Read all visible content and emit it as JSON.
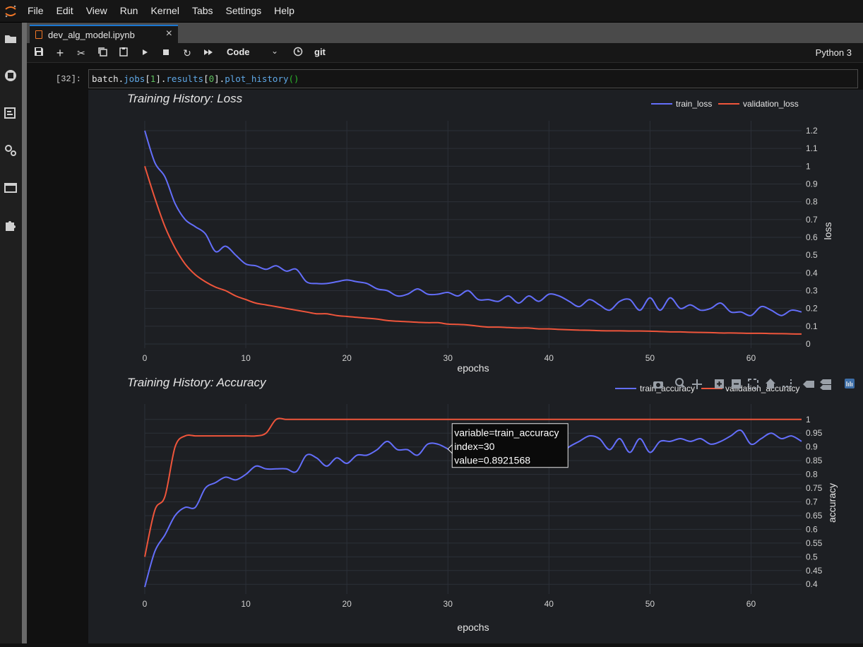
{
  "menubar": {
    "items": [
      "File",
      "Edit",
      "View",
      "Run",
      "Kernel",
      "Tabs",
      "Settings",
      "Help"
    ]
  },
  "sidebar": {
    "icons": [
      "folder-icon",
      "running-icon",
      "commands-icon",
      "property-inspector-icon",
      "tabs-icon",
      "extensions-icon"
    ]
  },
  "tab": {
    "title": "dev_alg_model.ipynb",
    "close_label": "×"
  },
  "toolbar": {
    "cell_type": "Code",
    "git_label": "git",
    "kernel_name": "Python 3",
    "icons": [
      "save-icon",
      "add-icon",
      "cut-icon",
      "copy-icon",
      "paste-icon",
      "run-icon",
      "stop-icon",
      "restart-icon",
      "fast-forward-icon",
      "clock-icon"
    ]
  },
  "cell": {
    "prompt": "[32]:",
    "code": {
      "t1": "batch.",
      "t2": "jobs",
      "t3": "[",
      "t4": "1",
      "t5": "].",
      "t6": "results",
      "t7": "[",
      "t8": "0",
      "t9": "].",
      "t10": "plot_history",
      "t11": "()"
    }
  },
  "colors": {
    "train": "#636efa",
    "validation": "#ef553b",
    "plot_bg": "#1d1f23",
    "grid": "#2c3038"
  },
  "modebar": {
    "icons": [
      "camera-icon",
      "zoom-icon",
      "pan-icon",
      "zoom-in-icon",
      "zoom-out-icon",
      "autoscale-icon",
      "home-icon",
      "spike-lines-icon",
      "hover-closest-icon",
      "hover-compare-icon",
      "plotly-logo-icon"
    ]
  },
  "chart_data": [
    {
      "type": "line",
      "title": "Training History: Loss",
      "xlabel": "epochs",
      "ylabel": "loss",
      "xlim": [
        0,
        65
      ],
      "ylim": [
        0,
        1.2
      ],
      "x_ticks": [
        0,
        10,
        20,
        30,
        40,
        50,
        60
      ],
      "y_ticks": [
        0,
        0.1,
        0.2,
        0.3,
        0.4,
        0.5,
        0.6,
        0.7,
        0.8,
        0.9,
        1,
        1.1,
        1.2
      ],
      "y_tick_labels": [
        "0",
        "0.1",
        "0.2",
        "0.3",
        "0.4",
        "0.5",
        "0.6",
        "0.7",
        "0.8",
        "0.9",
        "1",
        "1.1",
        "1.2"
      ],
      "grid": true,
      "legend_position": "top-right",
      "series": [
        {
          "name": "train_loss",
          "x": [
            0,
            1,
            2,
            3,
            4,
            5,
            6,
            7,
            8,
            9,
            10,
            11,
            12,
            13,
            14,
            15,
            16,
            17,
            18,
            19,
            20,
            21,
            22,
            23,
            24,
            25,
            26,
            27,
            28,
            29,
            30,
            31,
            32,
            33,
            34,
            35,
            36,
            37,
            38,
            39,
            40,
            41,
            42,
            43,
            44,
            45,
            46,
            47,
            48,
            49,
            50,
            51,
            52,
            53,
            54,
            55,
            56,
            57,
            58,
            59,
            60,
            61,
            62,
            63,
            64,
            65
          ],
          "values": [
            1.2,
            1.02,
            0.94,
            0.79,
            0.7,
            0.66,
            0.62,
            0.52,
            0.55,
            0.5,
            0.45,
            0.44,
            0.42,
            0.44,
            0.41,
            0.42,
            0.35,
            0.34,
            0.34,
            0.35,
            0.36,
            0.35,
            0.34,
            0.31,
            0.3,
            0.27,
            0.28,
            0.31,
            0.28,
            0.28,
            0.29,
            0.27,
            0.3,
            0.25,
            0.25,
            0.24,
            0.27,
            0.23,
            0.27,
            0.24,
            0.28,
            0.27,
            0.24,
            0.21,
            0.25,
            0.22,
            0.19,
            0.24,
            0.25,
            0.19,
            0.26,
            0.19,
            0.26,
            0.2,
            0.22,
            0.19,
            0.2,
            0.23,
            0.18,
            0.18,
            0.16,
            0.21,
            0.19,
            0.16,
            0.19,
            0.18
          ]
        },
        {
          "name": "validation_loss",
          "x": [
            0,
            1,
            2,
            3,
            4,
            5,
            6,
            7,
            8,
            9,
            10,
            11,
            12,
            13,
            14,
            15,
            16,
            17,
            18,
            19,
            20,
            21,
            22,
            23,
            24,
            25,
            26,
            27,
            28,
            29,
            30,
            31,
            32,
            33,
            34,
            35,
            36,
            37,
            38,
            39,
            40,
            41,
            42,
            43,
            44,
            45,
            46,
            47,
            48,
            49,
            50,
            51,
            52,
            53,
            54,
            55,
            56,
            57,
            58,
            59,
            60,
            61,
            62,
            63,
            64,
            65
          ],
          "values": [
            1.0,
            0.82,
            0.66,
            0.54,
            0.45,
            0.39,
            0.35,
            0.32,
            0.3,
            0.27,
            0.25,
            0.23,
            0.22,
            0.21,
            0.2,
            0.19,
            0.18,
            0.17,
            0.17,
            0.16,
            0.155,
            0.15,
            0.145,
            0.14,
            0.132,
            0.128,
            0.125,
            0.122,
            0.12,
            0.12,
            0.112,
            0.11,
            0.107,
            0.1,
            0.095,
            0.095,
            0.092,
            0.09,
            0.09,
            0.085,
            0.085,
            0.082,
            0.08,
            0.078,
            0.077,
            0.075,
            0.074,
            0.074,
            0.073,
            0.073,
            0.072,
            0.07,
            0.068,
            0.068,
            0.066,
            0.065,
            0.064,
            0.062,
            0.062,
            0.061,
            0.06,
            0.06,
            0.059,
            0.058,
            0.057,
            0.056
          ]
        }
      ]
    },
    {
      "type": "line",
      "title": "Training History: Accuracy",
      "xlabel": "epochs",
      "ylabel": "accuracy",
      "xlim": [
        0,
        65
      ],
      "ylim": [
        0.38,
        1.02
      ],
      "x_ticks": [
        0,
        10,
        20,
        30,
        40,
        50,
        60
      ],
      "y_ticks": [
        0.4,
        0.45,
        0.5,
        0.55,
        0.6,
        0.65,
        0.7,
        0.75,
        0.8,
        0.85,
        0.9,
        0.95,
        1
      ],
      "y_tick_labels": [
        "0.4",
        "0.45",
        "0.5",
        "0.55",
        "0.6",
        "0.65",
        "0.7",
        "0.75",
        "0.8",
        "0.85",
        "0.9",
        "0.95",
        "1"
      ],
      "grid": true,
      "legend_position": "top-right",
      "series": [
        {
          "name": "train_accuracy",
          "x": [
            0,
            1,
            2,
            3,
            4,
            5,
            6,
            7,
            8,
            9,
            10,
            11,
            12,
            13,
            14,
            15,
            16,
            17,
            18,
            19,
            20,
            21,
            22,
            23,
            24,
            25,
            26,
            27,
            28,
            29,
            30,
            31,
            32,
            33,
            34,
            35,
            36,
            37,
            38,
            39,
            40,
            41,
            42,
            43,
            44,
            45,
            46,
            47,
            48,
            49,
            50,
            51,
            52,
            53,
            54,
            55,
            56,
            57,
            58,
            59,
            60,
            61,
            62,
            63,
            64,
            65
          ],
          "values": [
            0.39,
            0.52,
            0.58,
            0.65,
            0.68,
            0.68,
            0.75,
            0.77,
            0.79,
            0.78,
            0.8,
            0.83,
            0.82,
            0.82,
            0.82,
            0.81,
            0.87,
            0.86,
            0.83,
            0.86,
            0.84,
            0.87,
            0.87,
            0.89,
            0.92,
            0.89,
            0.89,
            0.87,
            0.91,
            0.91,
            0.8921568,
            0.87,
            0.9,
            0.93,
            0.88,
            0.92,
            0.9,
            0.92,
            0.88,
            0.94,
            0.9,
            0.87,
            0.9,
            0.92,
            0.94,
            0.93,
            0.89,
            0.93,
            0.88,
            0.93,
            0.88,
            0.92,
            0.92,
            0.93,
            0.92,
            0.93,
            0.91,
            0.92,
            0.94,
            0.96,
            0.91,
            0.93,
            0.95,
            0.93,
            0.94,
            0.92
          ]
        },
        {
          "name": "validation_accuracy",
          "x": [
            0,
            1,
            2,
            3,
            4,
            5,
            6,
            7,
            8,
            9,
            10,
            11,
            12,
            13,
            14,
            15,
            16,
            17,
            18,
            19,
            20,
            21,
            22,
            23,
            24,
            25,
            26,
            27,
            28,
            29,
            30,
            31,
            32,
            33,
            34,
            35,
            36,
            37,
            38,
            39,
            40,
            41,
            42,
            43,
            44,
            45,
            46,
            47,
            48,
            49,
            50,
            51,
            52,
            53,
            54,
            55,
            56,
            57,
            58,
            59,
            60,
            61,
            62,
            63,
            64,
            65
          ],
          "values": [
            0.5,
            0.67,
            0.72,
            0.9,
            0.94,
            0.94,
            0.94,
            0.94,
            0.94,
            0.94,
            0.94,
            0.94,
            0.95,
            1.0,
            1.0,
            1.0,
            1.0,
            1.0,
            1.0,
            1.0,
            1.0,
            1.0,
            1.0,
            1.0,
            1.0,
            1.0,
            1.0,
            1.0,
            1.0,
            1.0,
            1.0,
            1.0,
            1.0,
            1.0,
            1.0,
            1.0,
            1.0,
            1.0,
            1.0,
            1.0,
            1.0,
            1.0,
            1.0,
            1.0,
            1.0,
            1.0,
            1.0,
            1.0,
            1.0,
            1.0,
            1.0,
            1.0,
            1.0,
            1.0,
            1.0,
            1.0,
            1.0,
            1.0,
            1.0,
            1.0,
            1.0,
            1.0,
            1.0,
            1.0,
            1.0,
            1.0
          ]
        }
      ],
      "hover": {
        "series_index": 0,
        "index": 30,
        "lines": [
          "variable=train_accuracy",
          "index=30",
          "value=0.8921568"
        ]
      }
    }
  ]
}
